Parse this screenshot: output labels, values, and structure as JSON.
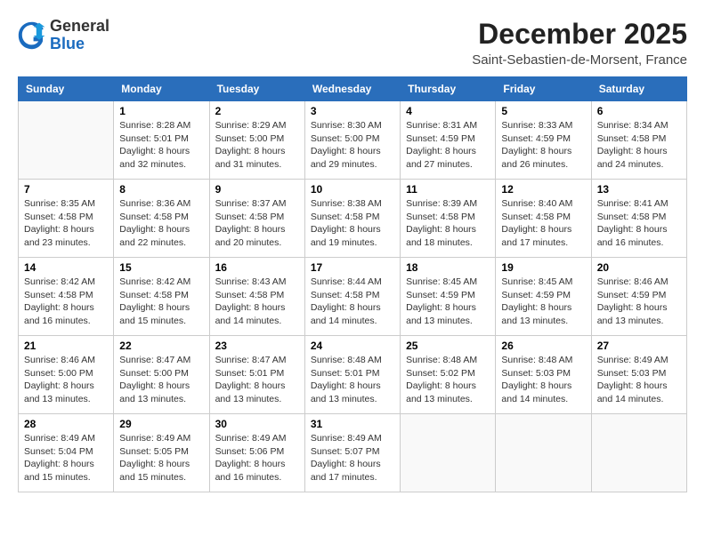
{
  "logo": {
    "general": "General",
    "blue": "Blue"
  },
  "header": {
    "month": "December 2025",
    "location": "Saint-Sebastien-de-Morsent, France"
  },
  "weekdays": [
    "Sunday",
    "Monday",
    "Tuesday",
    "Wednesday",
    "Thursday",
    "Friday",
    "Saturday"
  ],
  "weeks": [
    [
      {
        "day": "",
        "sunrise": "",
        "sunset": "",
        "daylight": "",
        "empty": true
      },
      {
        "day": "1",
        "sunrise": "Sunrise: 8:28 AM",
        "sunset": "Sunset: 5:01 PM",
        "daylight": "Daylight: 8 hours and 32 minutes."
      },
      {
        "day": "2",
        "sunrise": "Sunrise: 8:29 AM",
        "sunset": "Sunset: 5:00 PM",
        "daylight": "Daylight: 8 hours and 31 minutes."
      },
      {
        "day": "3",
        "sunrise": "Sunrise: 8:30 AM",
        "sunset": "Sunset: 5:00 PM",
        "daylight": "Daylight: 8 hours and 29 minutes."
      },
      {
        "day": "4",
        "sunrise": "Sunrise: 8:31 AM",
        "sunset": "Sunset: 4:59 PM",
        "daylight": "Daylight: 8 hours and 27 minutes."
      },
      {
        "day": "5",
        "sunrise": "Sunrise: 8:33 AM",
        "sunset": "Sunset: 4:59 PM",
        "daylight": "Daylight: 8 hours and 26 minutes."
      },
      {
        "day": "6",
        "sunrise": "Sunrise: 8:34 AM",
        "sunset": "Sunset: 4:58 PM",
        "daylight": "Daylight: 8 hours and 24 minutes."
      }
    ],
    [
      {
        "day": "7",
        "sunrise": "Sunrise: 8:35 AM",
        "sunset": "Sunset: 4:58 PM",
        "daylight": "Daylight: 8 hours and 23 minutes."
      },
      {
        "day": "8",
        "sunrise": "Sunrise: 8:36 AM",
        "sunset": "Sunset: 4:58 PM",
        "daylight": "Daylight: 8 hours and 22 minutes."
      },
      {
        "day": "9",
        "sunrise": "Sunrise: 8:37 AM",
        "sunset": "Sunset: 4:58 PM",
        "daylight": "Daylight: 8 hours and 20 minutes."
      },
      {
        "day": "10",
        "sunrise": "Sunrise: 8:38 AM",
        "sunset": "Sunset: 4:58 PM",
        "daylight": "Daylight: 8 hours and 19 minutes."
      },
      {
        "day": "11",
        "sunrise": "Sunrise: 8:39 AM",
        "sunset": "Sunset: 4:58 PM",
        "daylight": "Daylight: 8 hours and 18 minutes."
      },
      {
        "day": "12",
        "sunrise": "Sunrise: 8:40 AM",
        "sunset": "Sunset: 4:58 PM",
        "daylight": "Daylight: 8 hours and 17 minutes."
      },
      {
        "day": "13",
        "sunrise": "Sunrise: 8:41 AM",
        "sunset": "Sunset: 4:58 PM",
        "daylight": "Daylight: 8 hours and 16 minutes."
      }
    ],
    [
      {
        "day": "14",
        "sunrise": "Sunrise: 8:42 AM",
        "sunset": "Sunset: 4:58 PM",
        "daylight": "Daylight: 8 hours and 16 minutes."
      },
      {
        "day": "15",
        "sunrise": "Sunrise: 8:42 AM",
        "sunset": "Sunset: 4:58 PM",
        "daylight": "Daylight: 8 hours and 15 minutes."
      },
      {
        "day": "16",
        "sunrise": "Sunrise: 8:43 AM",
        "sunset": "Sunset: 4:58 PM",
        "daylight": "Daylight: 8 hours and 14 minutes."
      },
      {
        "day": "17",
        "sunrise": "Sunrise: 8:44 AM",
        "sunset": "Sunset: 4:58 PM",
        "daylight": "Daylight: 8 hours and 14 minutes."
      },
      {
        "day": "18",
        "sunrise": "Sunrise: 8:45 AM",
        "sunset": "Sunset: 4:59 PM",
        "daylight": "Daylight: 8 hours and 13 minutes."
      },
      {
        "day": "19",
        "sunrise": "Sunrise: 8:45 AM",
        "sunset": "Sunset: 4:59 PM",
        "daylight": "Daylight: 8 hours and 13 minutes."
      },
      {
        "day": "20",
        "sunrise": "Sunrise: 8:46 AM",
        "sunset": "Sunset: 4:59 PM",
        "daylight": "Daylight: 8 hours and 13 minutes."
      }
    ],
    [
      {
        "day": "21",
        "sunrise": "Sunrise: 8:46 AM",
        "sunset": "Sunset: 5:00 PM",
        "daylight": "Daylight: 8 hours and 13 minutes."
      },
      {
        "day": "22",
        "sunrise": "Sunrise: 8:47 AM",
        "sunset": "Sunset: 5:00 PM",
        "daylight": "Daylight: 8 hours and 13 minutes."
      },
      {
        "day": "23",
        "sunrise": "Sunrise: 8:47 AM",
        "sunset": "Sunset: 5:01 PM",
        "daylight": "Daylight: 8 hours and 13 minutes."
      },
      {
        "day": "24",
        "sunrise": "Sunrise: 8:48 AM",
        "sunset": "Sunset: 5:01 PM",
        "daylight": "Daylight: 8 hours and 13 minutes."
      },
      {
        "day": "25",
        "sunrise": "Sunrise: 8:48 AM",
        "sunset": "Sunset: 5:02 PM",
        "daylight": "Daylight: 8 hours and 13 minutes."
      },
      {
        "day": "26",
        "sunrise": "Sunrise: 8:48 AM",
        "sunset": "Sunset: 5:03 PM",
        "daylight": "Daylight: 8 hours and 14 minutes."
      },
      {
        "day": "27",
        "sunrise": "Sunrise: 8:49 AM",
        "sunset": "Sunset: 5:03 PM",
        "daylight": "Daylight: 8 hours and 14 minutes."
      }
    ],
    [
      {
        "day": "28",
        "sunrise": "Sunrise: 8:49 AM",
        "sunset": "Sunset: 5:04 PM",
        "daylight": "Daylight: 8 hours and 15 minutes."
      },
      {
        "day": "29",
        "sunrise": "Sunrise: 8:49 AM",
        "sunset": "Sunset: 5:05 PM",
        "daylight": "Daylight: 8 hours and 15 minutes."
      },
      {
        "day": "30",
        "sunrise": "Sunrise: 8:49 AM",
        "sunset": "Sunset: 5:06 PM",
        "daylight": "Daylight: 8 hours and 16 minutes."
      },
      {
        "day": "31",
        "sunrise": "Sunrise: 8:49 AM",
        "sunset": "Sunset: 5:07 PM",
        "daylight": "Daylight: 8 hours and 17 minutes."
      },
      {
        "day": "",
        "sunrise": "",
        "sunset": "",
        "daylight": "",
        "empty": true
      },
      {
        "day": "",
        "sunrise": "",
        "sunset": "",
        "daylight": "",
        "empty": true
      },
      {
        "day": "",
        "sunrise": "",
        "sunset": "",
        "daylight": "",
        "empty": true
      }
    ]
  ]
}
